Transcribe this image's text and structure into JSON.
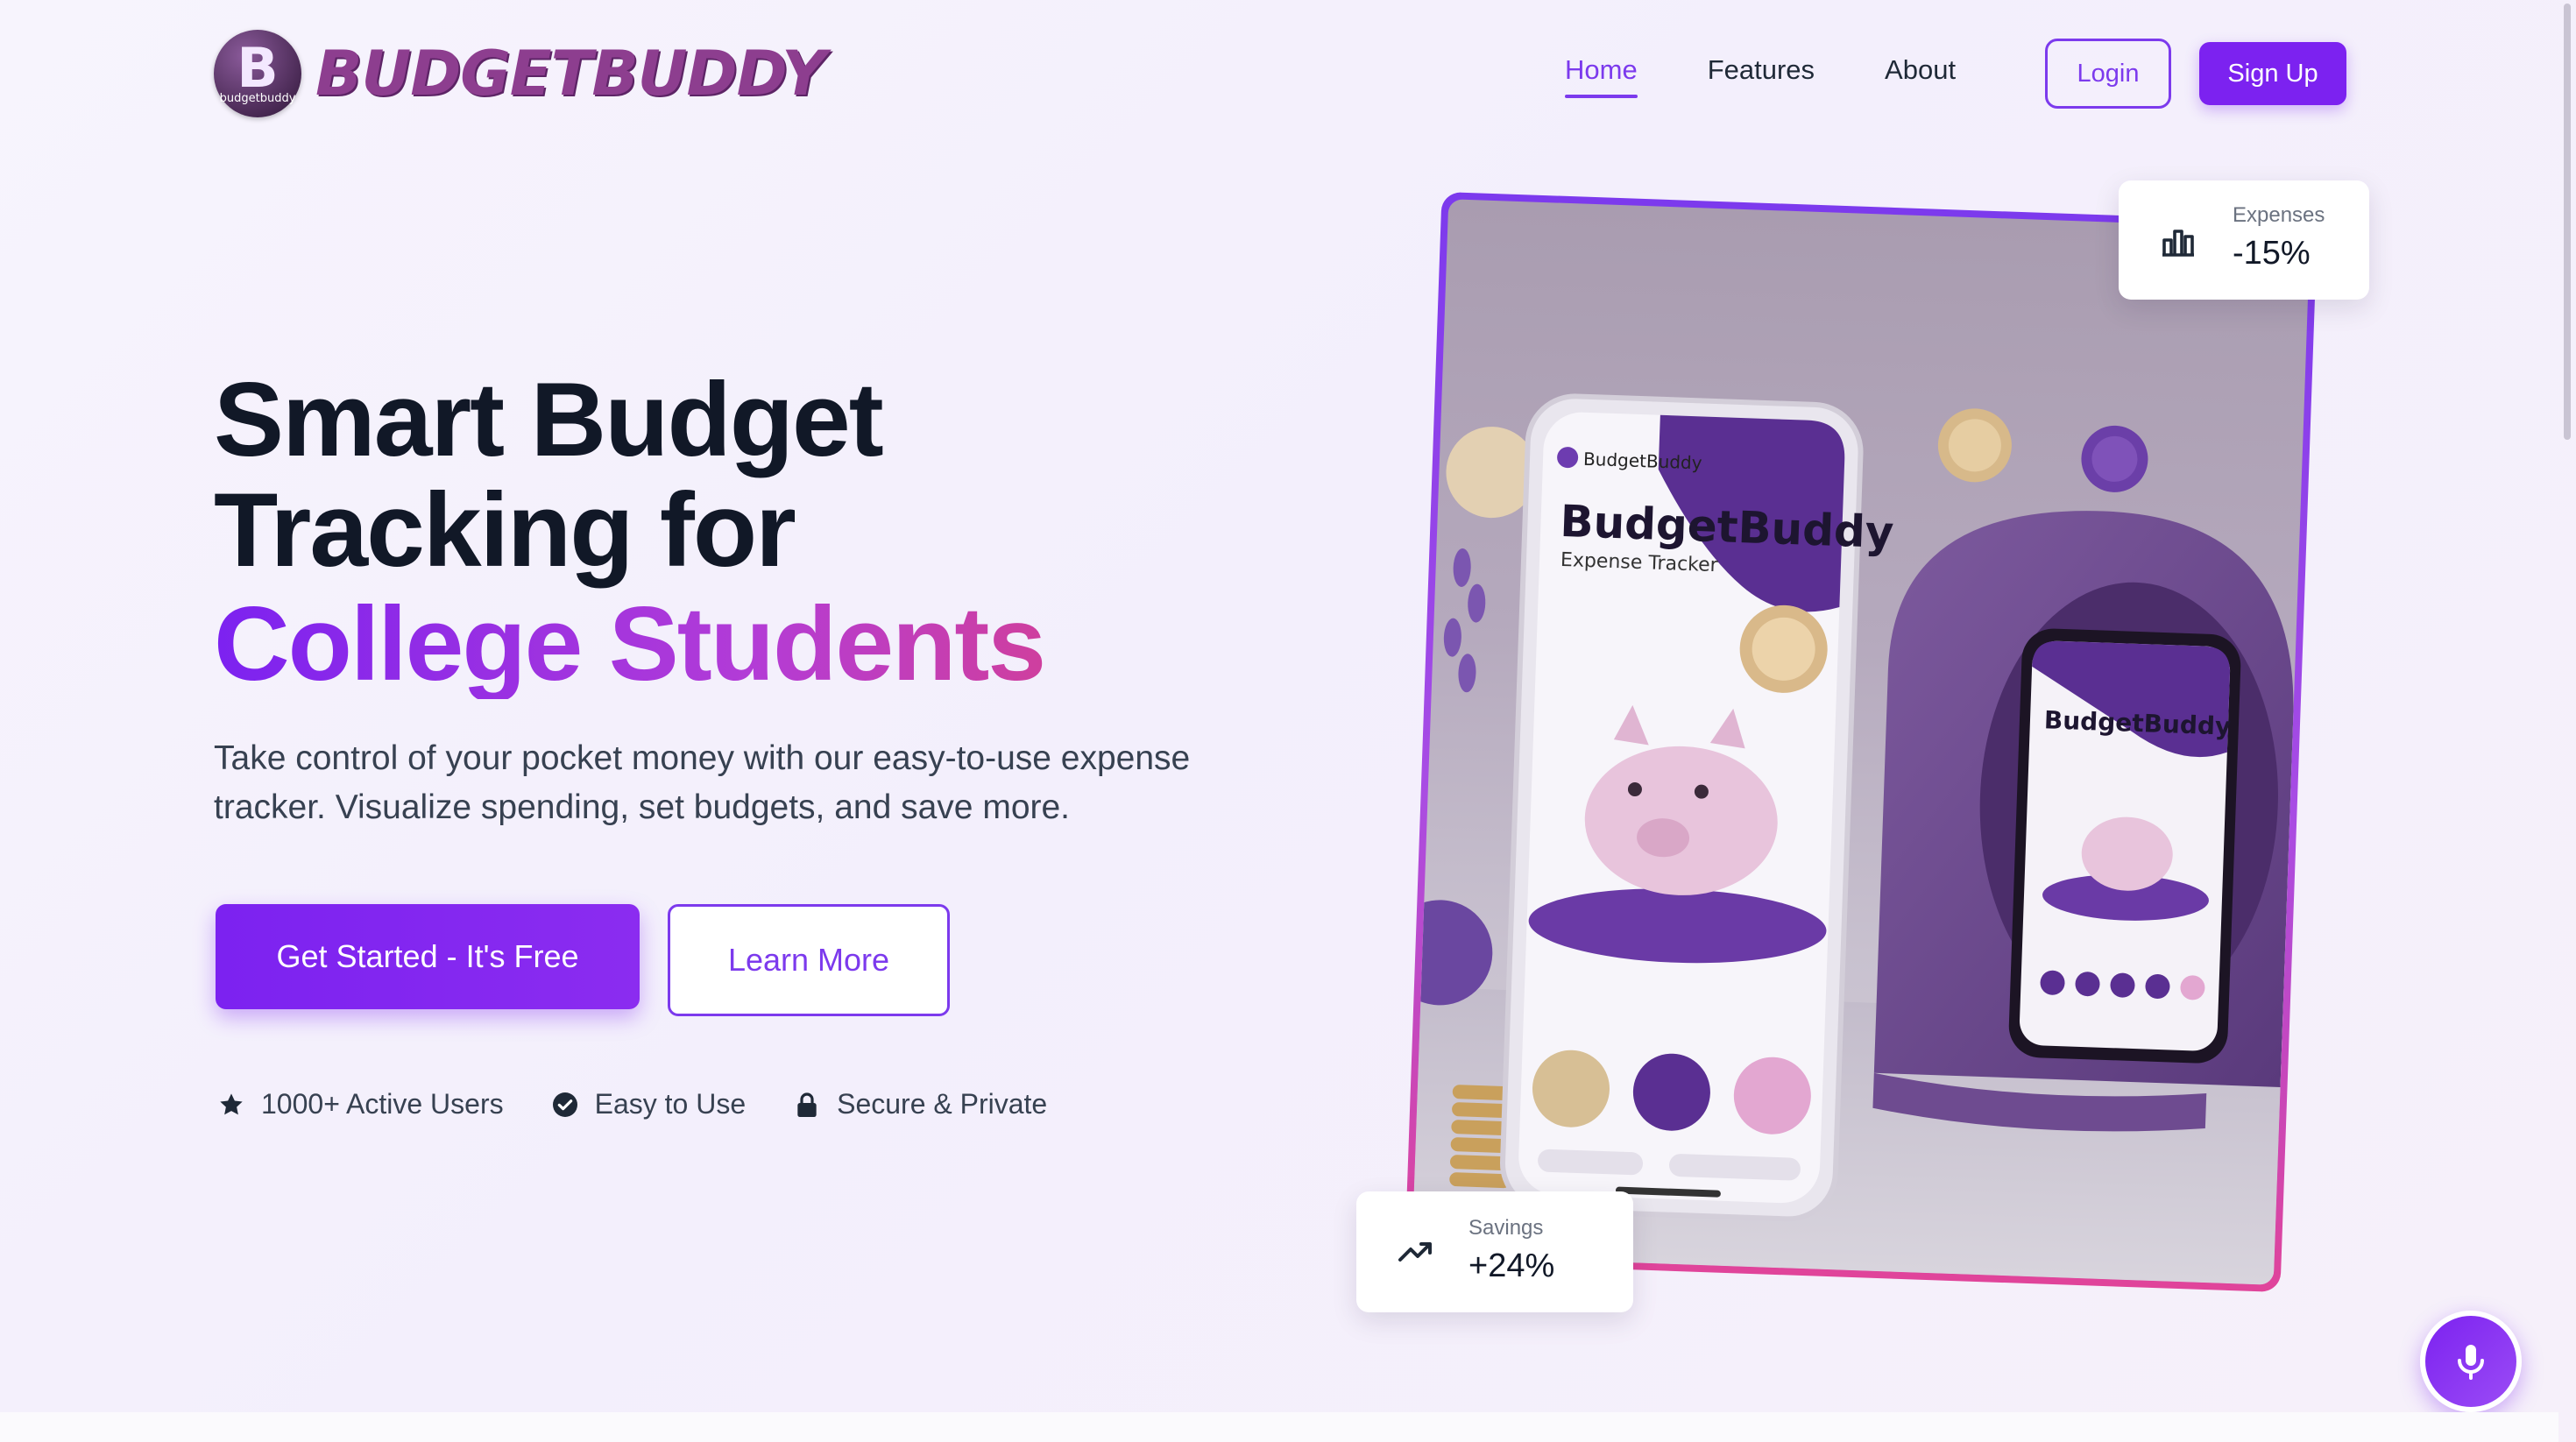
{
  "brand": {
    "logo_letter": "B",
    "logo_caption": "budgetbuddy",
    "name": "BUDGETBUDDY"
  },
  "nav": {
    "items": [
      {
        "label": "Home",
        "active": true
      },
      {
        "label": "Features",
        "active": false
      },
      {
        "label": "About",
        "active": false
      }
    ],
    "login_label": "Login",
    "signup_label": "Sign Up"
  },
  "hero": {
    "title_line1": "Smart Budget",
    "title_line2": "Tracking for",
    "title_accent": "College Students",
    "subtitle": "Take control of your pocket money with our easy-to-use expense tracker. Visualize spending, set budgets, and save more.",
    "primary_cta": "Get Started - It's Free",
    "secondary_cta": "Learn More",
    "features": [
      {
        "icon": "star-icon",
        "label": "1000+ Active Users"
      },
      {
        "icon": "check-circle-icon",
        "label": "Easy to Use"
      },
      {
        "icon": "lock-icon",
        "label": "Secure & Private"
      }
    ]
  },
  "illustration": {
    "phone_app_name": "BudgetBuddy",
    "phone_app_subtitle": "Expense Tracker",
    "small_phone_app_name": "BudgetBuddy"
  },
  "stats": {
    "expenses": {
      "label": "Expenses",
      "value": "-15%",
      "icon": "bar-chart-icon"
    },
    "savings": {
      "label": "Savings",
      "value": "+24%",
      "icon": "trending-up-icon"
    }
  },
  "colors": {
    "accent": "#7c22f0",
    "accent_pink": "#cf3f9e",
    "text_dark": "#111827"
  },
  "floating_button": {
    "icon": "microphone-icon"
  }
}
